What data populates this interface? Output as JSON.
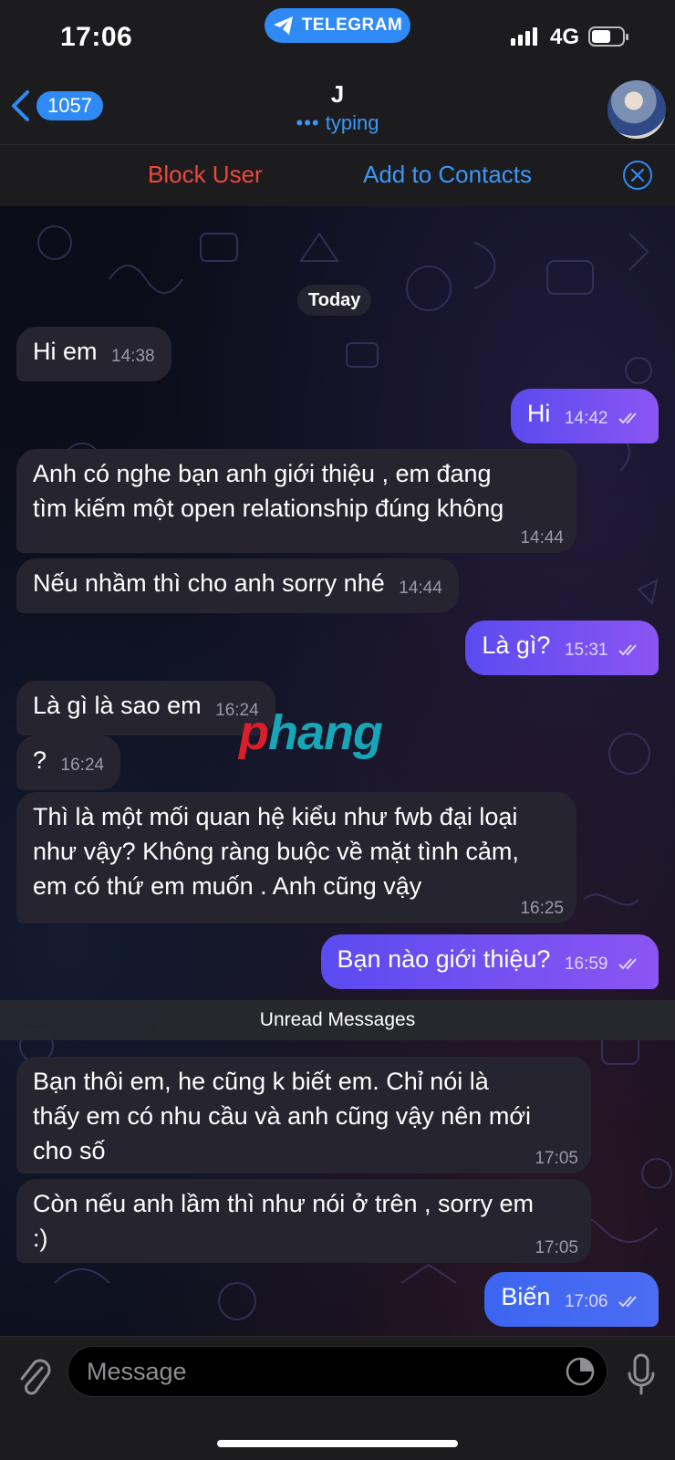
{
  "status_bar": {
    "time": "17:06",
    "app_pill": "TELEGRAM",
    "network": "4G"
  },
  "header": {
    "back_count": "1057",
    "title": "J",
    "subtitle": "typing"
  },
  "actions": {
    "block": "Block User",
    "add": "Add to Contacts"
  },
  "chat": {
    "date": "Today",
    "unread_label": "Unread Messages",
    "watermark": "phang",
    "messages": [
      {
        "dir": "in",
        "text": "Hi em",
        "time": "14:38"
      },
      {
        "dir": "out",
        "text": "Hi",
        "time": "14:42"
      },
      {
        "dir": "in",
        "lines": [
          "Anh có nghe bạn anh giới thiệu , em đang",
          "tìm kiếm một open relationship đúng không"
        ],
        "time": "14:44"
      },
      {
        "dir": "in",
        "text": "Nếu nhầm thì cho anh sorry nhé",
        "time": "14:44"
      },
      {
        "dir": "out",
        "text": "Là gì?",
        "time": "15:31"
      },
      {
        "dir": "in",
        "text": "Là gì là sao em",
        "time": "16:24"
      },
      {
        "dir": "in",
        "text": "?",
        "time": "16:24"
      },
      {
        "dir": "in",
        "lines": [
          "Thì là một mối quan hệ kiểu như fwb đại loại",
          "như vậy? Không ràng buộc về mặt tình cảm,",
          "em có thứ em muốn . Anh cũng vậy"
        ],
        "time": "16:25"
      },
      {
        "dir": "out",
        "text": "Bạn nào giới thiệu?",
        "time": "16:59"
      },
      {
        "dir": "in",
        "lines": [
          "Bạn thôi em, he cũng k biết em. Chỉ nói là",
          "thấy em có nhu cầu và anh cũng vậy nên mới",
          "cho số"
        ],
        "time": "17:05"
      },
      {
        "dir": "in",
        "lines": [
          "Còn nếu anh lầm thì như nói ở trên , sorry em",
          ":)"
        ],
        "time": "17:05"
      },
      {
        "dir": "out",
        "text": "Biến",
        "time": "17:06"
      }
    ]
  },
  "composer": {
    "placeholder": "Message"
  },
  "colors": {
    "accent": "#2f8af5",
    "danger": "#f0463c",
    "outgoing": "#7a52f2",
    "incoming": "#26242f"
  }
}
